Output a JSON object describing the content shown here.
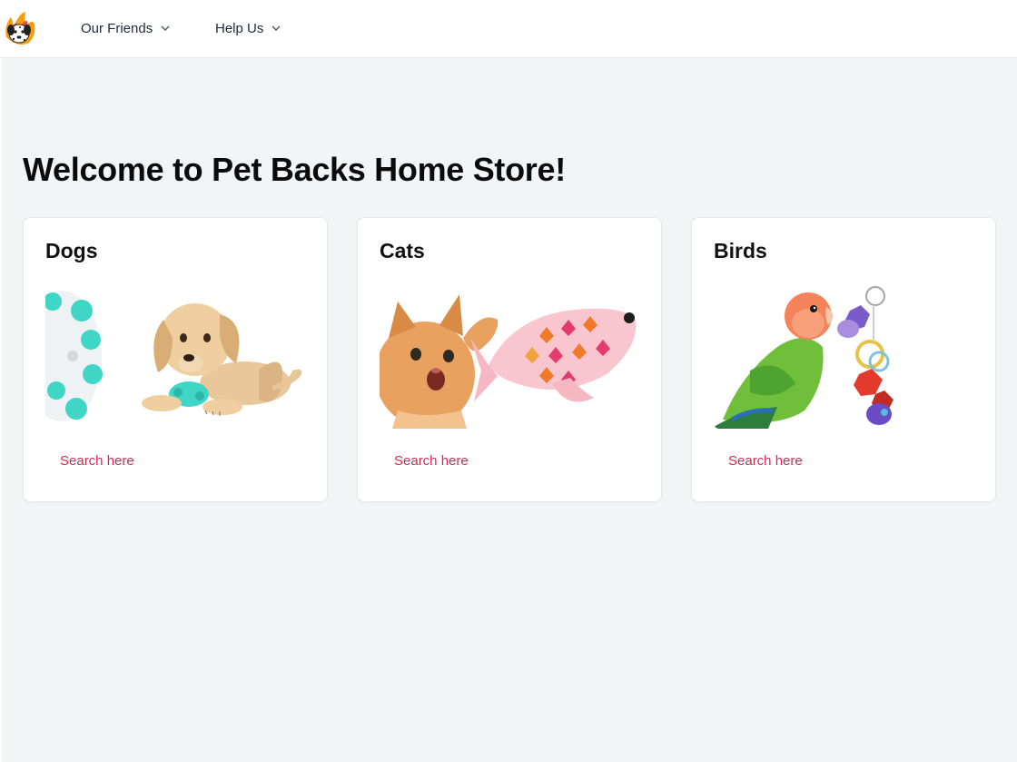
{
  "header": {
    "logo_icon": "dalmatian-logo-icon",
    "nav": [
      {
        "label": "Our Friends",
        "icon": "chevron-down-icon"
      },
      {
        "label": "Help Us",
        "icon": "chevron-down-icon"
      }
    ]
  },
  "main": {
    "title": "Welcome to Pet Backs Home Store!",
    "cards": [
      {
        "title": "Dogs",
        "image": "puppy-with-toy-image",
        "link": "Search here"
      },
      {
        "title": "Cats",
        "image": "kitten-with-fish-toy-image",
        "link": "Search here"
      },
      {
        "title": "Birds",
        "image": "lovebird-with-toy-image",
        "link": "Search here"
      }
    ]
  },
  "colors": {
    "background": "#f3f4f6",
    "link": "#db2755",
    "card": "#ffffff"
  }
}
